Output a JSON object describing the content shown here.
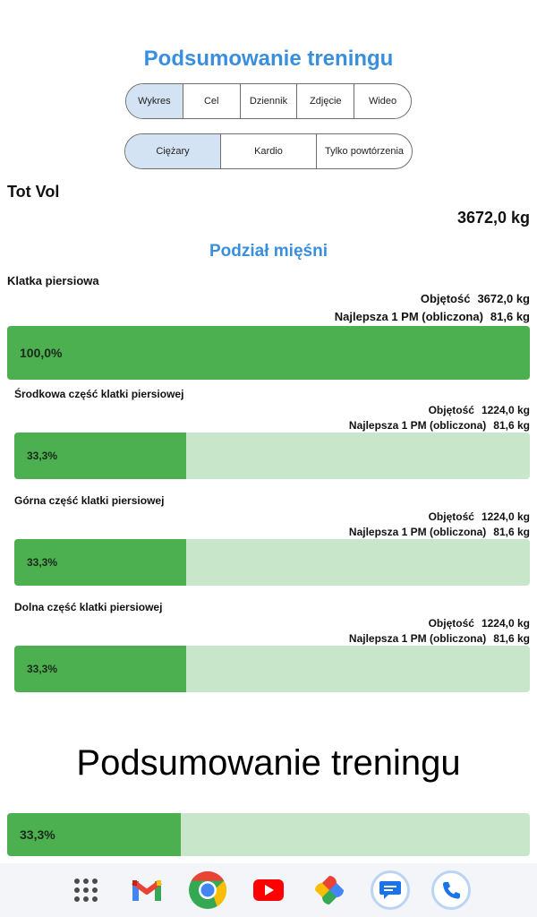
{
  "header": {
    "title": "Podsumowanie treningu"
  },
  "tabs_top": [
    "Wykres",
    "Cel",
    "Dziennik",
    "Zdjęcie",
    "Wideo"
  ],
  "tabs_type": [
    "Ciężary",
    "Kardio",
    "Tylko powtórzenia"
  ],
  "total": {
    "label": "Tot Vol",
    "value": "3672,0 kg"
  },
  "breakdown": {
    "title": "Podział mięśni",
    "group": {
      "name": "Klatka piersiowa",
      "volume_label": "Objętość",
      "volume": "3672,0 kg",
      "best_label": "Najlepsza 1 PM (obliczona)",
      "best": "81,6 kg",
      "pct_text": "100,0%",
      "fraction": 1.0
    },
    "subs": [
      {
        "name": "Środkowa część klatki piersiowej",
        "volume_label": "Objętość",
        "volume": "1224,0 kg",
        "best_label": "Najlepsza 1 PM (obliczona)",
        "best": "81,6 kg",
        "pct_text": "33,3%",
        "fraction": 0.333
      },
      {
        "name": "Górna część klatki piersiowej",
        "volume_label": "Objętość",
        "volume": "1224,0 kg",
        "best_label": "Najlepsza 1 PM (obliczona)",
        "best": "81,6 kg",
        "pct_text": "33,3%",
        "fraction": 0.333
      },
      {
        "name": "Dolna część klatki piersiowej",
        "volume_label": "Objętość",
        "volume": "1224,0 kg",
        "best_label": "Najlepsza 1 PM (obliczona)",
        "best": "81,6 kg",
        "pct_text": "33,3%",
        "fraction": 0.333
      }
    ]
  },
  "overlay_text": "Podsumowanie treningu",
  "partial_bar": {
    "pct_text": "33,3%",
    "fraction": 0.333
  },
  "navbar": [
    "apps-grid-icon",
    "gmail-icon",
    "chrome-icon",
    "youtube-icon",
    "photos-icon",
    "messages-icon",
    "phone-icon"
  ],
  "colors": {
    "accent": "#3a8fdc",
    "bar_fill": "#4caf50",
    "bar_track": "#c8e6c9",
    "selected_tab": "#d3e3f4"
  }
}
